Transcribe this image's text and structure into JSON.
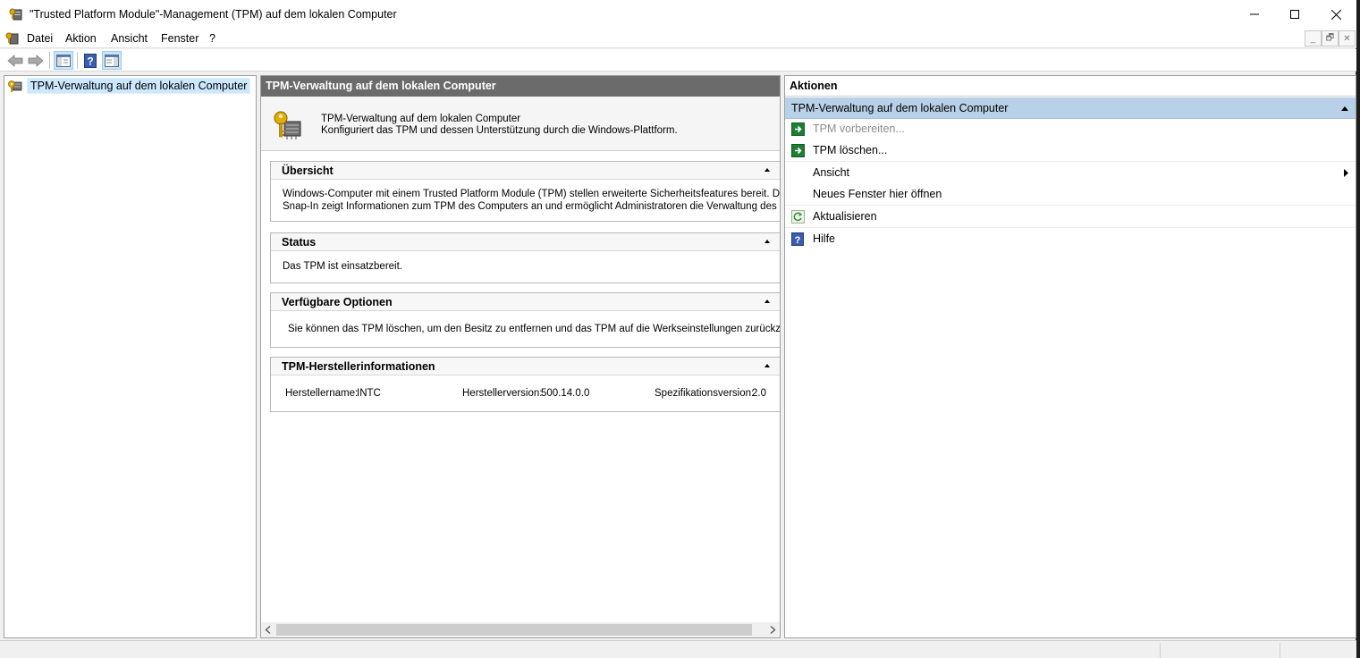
{
  "window": {
    "title": "\"Trusted Platform Module\"-Management (TPM) auf dem lokalen Computer"
  },
  "menubar": {
    "items": [
      "Datei",
      "Aktion",
      "Ansicht",
      "Fenster",
      "?"
    ],
    "mdi_minimize": "_",
    "mdi_restore": "🗗",
    "mdi_close": "✕"
  },
  "toolbar": {
    "buttons": [
      "back-icon",
      "forward-icon",
      "show-hide-console-tree-icon",
      "help-icon",
      "show-hide-action-pane-icon"
    ]
  },
  "tree": {
    "root_label": "TPM-Verwaltung auf dem lokalen Computer"
  },
  "center": {
    "header": "TPM-Verwaltung auf dem lokalen Computer",
    "intro_title": "TPM-Verwaltung auf dem lokalen Computer",
    "intro_desc": "Konfiguriert das TPM und dessen Unterstützung durch die Windows-Plattform.",
    "overview": {
      "title": "Übersicht",
      "line1": "Windows-Computer mit einem Trusted Platform Module (TPM) stellen erweiterte Sicherheitsfeatures bereit. Dieses",
      "line2": "Snap-In zeigt Informationen zum TPM des Computers an und ermöglicht Administratoren die Verwaltung des Geräts."
    },
    "status": {
      "title": "Status",
      "text": "Das TPM ist einsatzbereit."
    },
    "options": {
      "title": "Verfügbare Optionen",
      "text": "Sie können das TPM löschen, um den Besitz zu entfernen und das TPM auf die Werkseinstellungen zurückzusetzen"
    },
    "manufacturer": {
      "title": "TPM-Herstellerinformationen",
      "name_label": "Herstellername:",
      "name_value": "INTC",
      "version_label": "Herstellerversion:",
      "version_value": "500.14.0.0",
      "spec_label": "Spezifikationsversion:",
      "spec_value": "2.0"
    }
  },
  "actions": {
    "header": "Aktionen",
    "group": "TPM-Verwaltung auf dem lokalen Computer",
    "items": [
      {
        "label": "TPM vorbereiten...",
        "icon": "run-action-icon",
        "enabled": false
      },
      {
        "label": "TPM löschen...",
        "icon": "run-action-icon",
        "enabled": true
      },
      {
        "label": "Ansicht",
        "icon": "",
        "enabled": true
      },
      {
        "label": "Neues Fenster hier öffnen",
        "icon": "",
        "enabled": true
      },
      {
        "label": "Aktualisieren",
        "icon": "refresh-icon",
        "enabled": true
      },
      {
        "label": "Hilfe",
        "icon": "help-icon",
        "enabled": true
      }
    ]
  },
  "colors": {
    "selection": "#cce8ff",
    "actions_group": "#b8d1e8",
    "center_header": "#6b6b6b",
    "run_icon": "#1e7e34"
  }
}
